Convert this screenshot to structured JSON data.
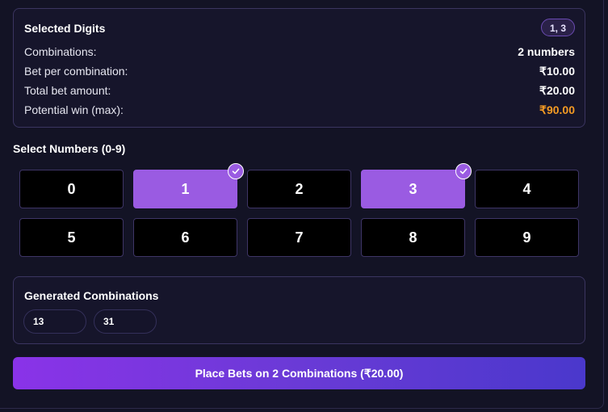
{
  "summary": {
    "title": "Selected Digits",
    "digits_badge": "1, 3",
    "rows": [
      {
        "label": "Combinations:",
        "value": "2 numbers"
      },
      {
        "label": "Bet per combination:",
        "value": "₹10.00"
      },
      {
        "label": "Total bet amount:",
        "value": "₹20.00"
      },
      {
        "label": "Potential win (max):",
        "value": "₹90.00",
        "color": "#f59b23"
      }
    ]
  },
  "select": {
    "label": "Select Numbers (0-9)",
    "numbers": [
      "0",
      "1",
      "2",
      "3",
      "4",
      "5",
      "6",
      "7",
      "8",
      "9"
    ],
    "selected": [
      "1",
      "3"
    ],
    "selected_color": "#9a5be2"
  },
  "generated": {
    "title": "Generated Combinations",
    "items": [
      "13",
      "31"
    ]
  },
  "cta": {
    "label": "Place Bets on 2 Combinations (₹20.00)"
  }
}
